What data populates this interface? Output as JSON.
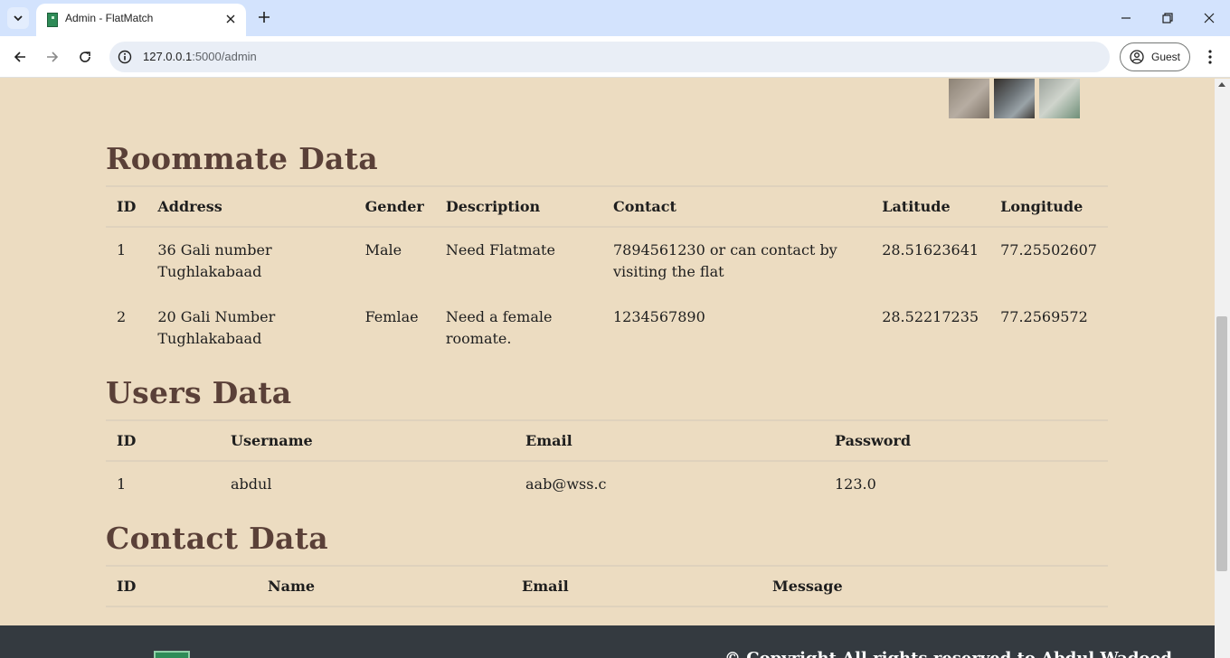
{
  "browser": {
    "tab_title": "Admin - FlatMatch",
    "url_host": "127.0.0.1",
    "url_rest": ":5000/admin",
    "profile_label": "Guest"
  },
  "roommate": {
    "title": "Roommate Data",
    "headers": [
      "ID",
      "Address",
      "Gender",
      "Description",
      "Contact",
      "Latitude",
      "Longitude"
    ],
    "rows": [
      [
        "1",
        "36 Gali number Tughlakabaad",
        "Male",
        "Need Flatmate",
        "7894561230 or can contact by visiting the flat",
        "28.51623641",
        "77.25502607"
      ],
      [
        "2",
        "20 Gali Number Tughlakabaad",
        "Femlae",
        "Need a female roomate.",
        "1234567890",
        "28.52217235",
        "77.2569572"
      ]
    ]
  },
  "users": {
    "title": "Users Data",
    "headers": [
      "ID",
      "Username",
      "Email",
      "Password"
    ],
    "rows": [
      [
        "1",
        "abdul",
        "aab@wss.c",
        "123.0"
      ]
    ]
  },
  "contact": {
    "title": "Contact Data",
    "headers": [
      "ID",
      "Name",
      "Email",
      "Message"
    ],
    "rows": []
  },
  "footer": {
    "copyright": "© Copyright All rights reserved to Abdul Wadood"
  }
}
